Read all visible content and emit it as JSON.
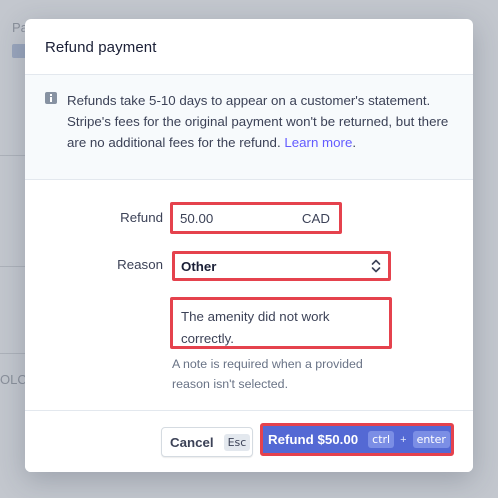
{
  "modal": {
    "title": "Refund payment",
    "notice": {
      "text": "Refunds take 5-10 days to appear on a customer's statement. Stripe's fees for the original payment won't be returned, but there are no additional fees for the refund.",
      "link": "Learn more",
      "suffix": "."
    },
    "refund": {
      "label": "Refund",
      "amount": "50.00",
      "currency": "CAD"
    },
    "reason": {
      "label": "Reason",
      "selected": "Other"
    },
    "note": {
      "value": "The amenity did not work correctly.",
      "hint": "A note is required when a provided reason isn't selected."
    },
    "footer": {
      "cancel_label": "Cancel",
      "cancel_shortcut": "Esc",
      "submit_label": "Refund $50.00",
      "submit_key1": "ctrl",
      "submit_plus": "+",
      "submit_key2": "enter"
    }
  },
  "background": {
    "fragment_top": "Pa",
    "fragment_mid": "OLC"
  },
  "colors": {
    "accent": "#5469d4",
    "link": "#635bff",
    "highlight": "#e5424d"
  },
  "icons": {
    "notice": "info-icon",
    "select": "chevron-up-down-icon"
  }
}
